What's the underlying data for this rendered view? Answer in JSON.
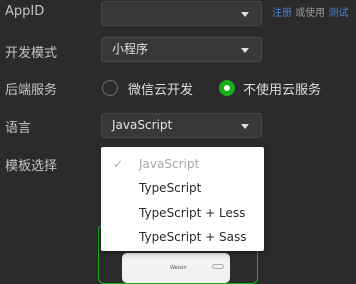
{
  "form": {
    "appid_label": "AppID",
    "appid_value": "",
    "register_link": "注册",
    "or_text": "或使用",
    "test_link": "测试",
    "dev_mode_label": "开发模式",
    "dev_mode_value": "小程序",
    "backend_label": "后端服务",
    "backend_options": [
      "微信云开发",
      "不使用云服务"
    ],
    "backend_selected": "不使用云服务",
    "language_label": "语言",
    "language_value": "JavaScript",
    "template_label": "模板选择"
  },
  "language_dropdown": {
    "options": [
      "JavaScript",
      "TypeScript",
      "TypeScript + Less",
      "TypeScript + Sass"
    ],
    "selected": "JavaScript"
  },
  "preview": {
    "phone_title": "Weixin"
  },
  "colors": {
    "accent": "#1aad19",
    "link": "#4f7ed8",
    "background": "#2b2b2b"
  }
}
